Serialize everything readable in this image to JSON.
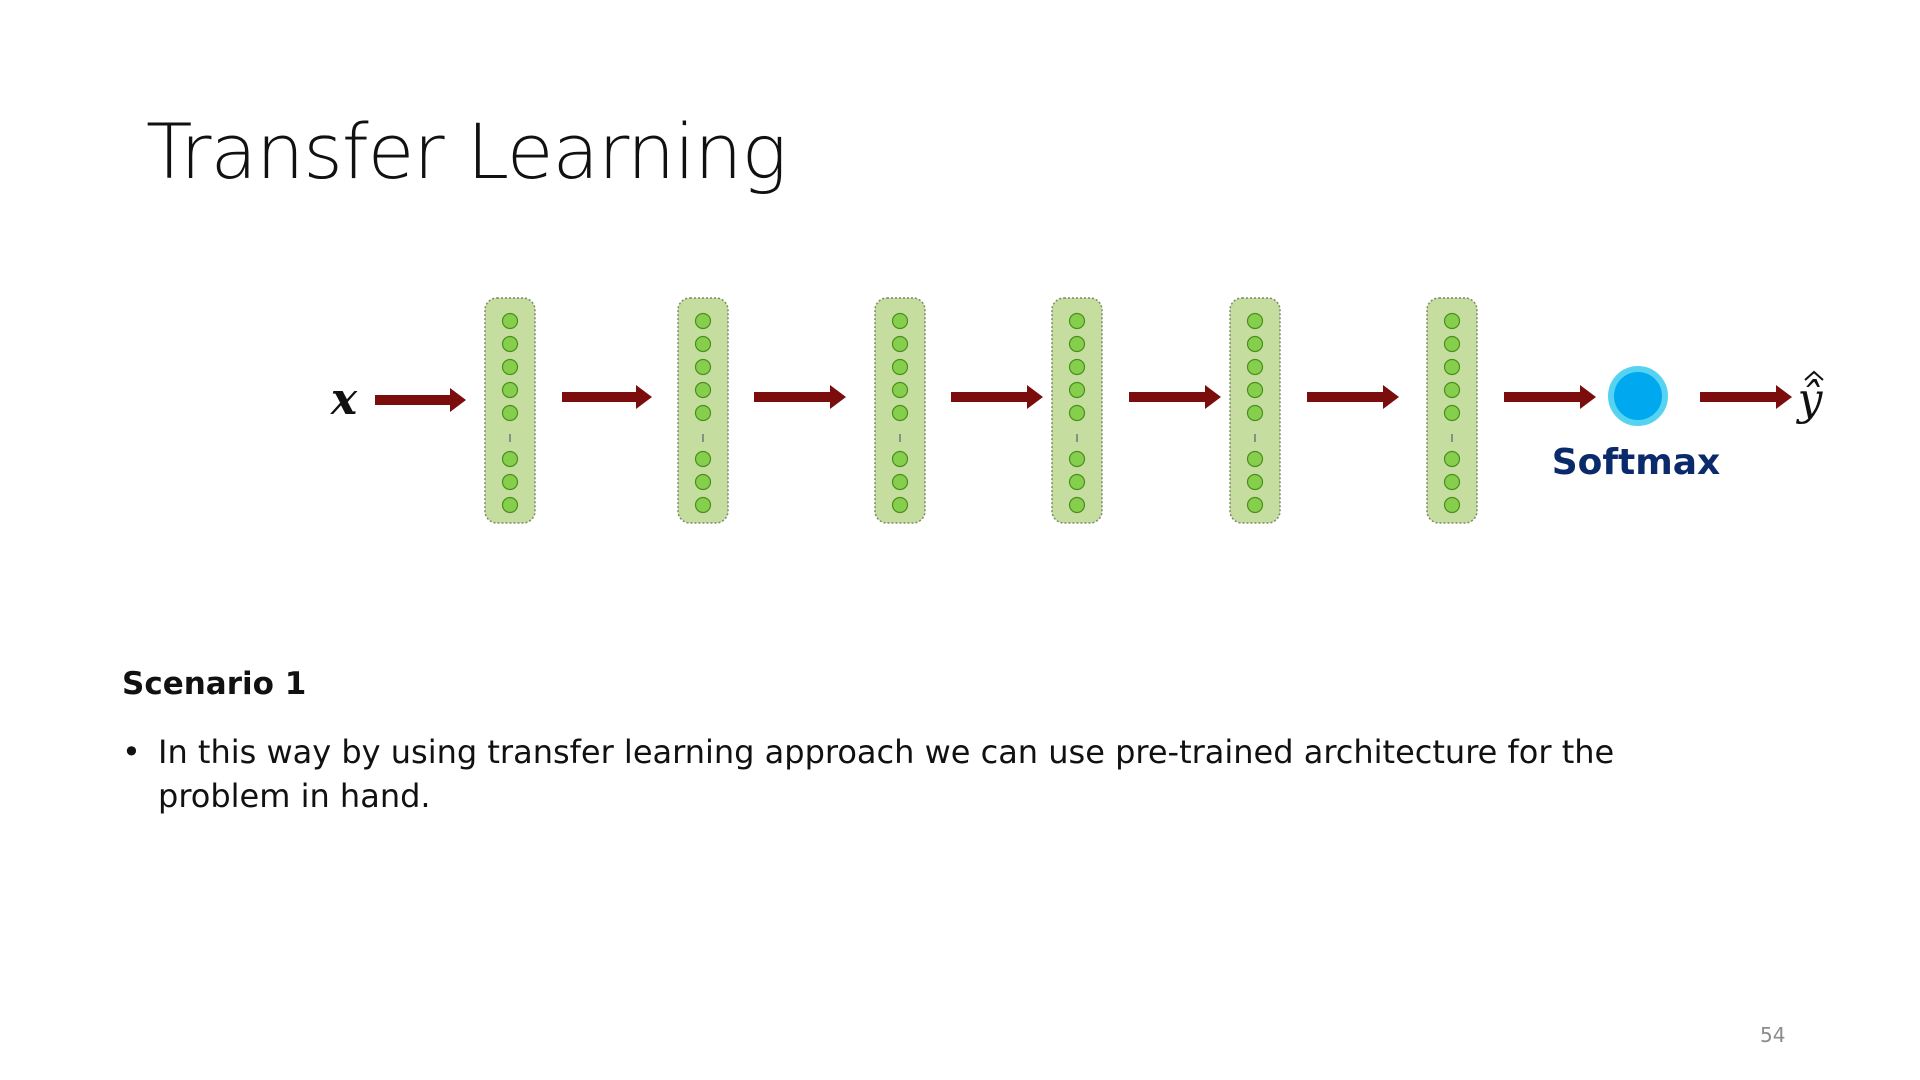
{
  "slide": {
    "title": "Transfer Learning",
    "page_number": "54"
  },
  "diagram": {
    "input_label": "x",
    "output_label": "ŷ",
    "output_unit_label": "Softmax",
    "hidden_layer_count": 6,
    "neurons_per_layer_visible": 8,
    "colors": {
      "arrow": "#7b0d0d",
      "layer_fill": "#c5dd9f",
      "layer_border": "#7c8a6a",
      "neuron_fill": "#86cf4d",
      "neuron_border": "#4a8e1e",
      "softmax_fill": "#00a8f0",
      "softmax_ring": "#55d3f0",
      "softmax_label": "#0b2a6b"
    }
  },
  "content": {
    "scenario_heading": "Scenario 1",
    "bullets": [
      "In this way by using transfer learning approach we can use pre-trained architecture for the problem in hand."
    ],
    "bullet_symbol": "•"
  }
}
